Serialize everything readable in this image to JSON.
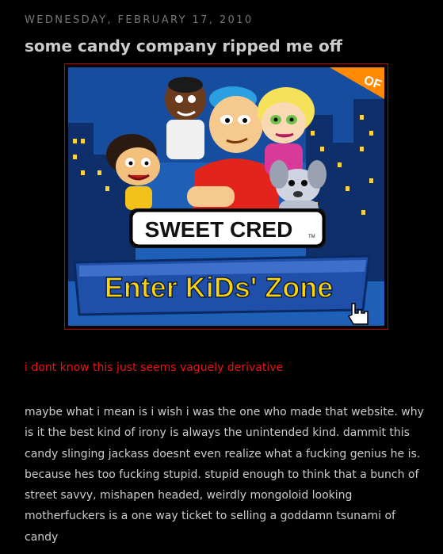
{
  "post": {
    "date": "WEDNESDAY, FEBRUARY 17, 2010",
    "title": "some candy company ripped me off",
    "image": {
      "logo_text": "SWEET CRED",
      "tm": "TM",
      "banner_text": "Enter KiDs' Zone",
      "corner_badge": "OF"
    },
    "highlight": "i dont know this just seems vaguely derivative",
    "body": "maybe what i mean is i wish i was the one who made that website. why is it the best kind of irony is always the unintended kind. dammit this candy slinging jackass doesnt even realize what a fucking genius he is. because hes too fucking stupid. stupid enough to think that a bunch of street savvy, mishapen headed, weirdly mongoloid looking motherfuckers is a one way ticket to selling a goddamn tsunami of candy"
  },
  "colors": {
    "background": "#000000",
    "text": "#cccccc",
    "date": "#777777",
    "highlight": "#ee1111",
    "frame_border": "#c40000",
    "image_sky": "#1e5fb8",
    "banner": "#1f4fa8",
    "banner_text": "#ffd400"
  }
}
